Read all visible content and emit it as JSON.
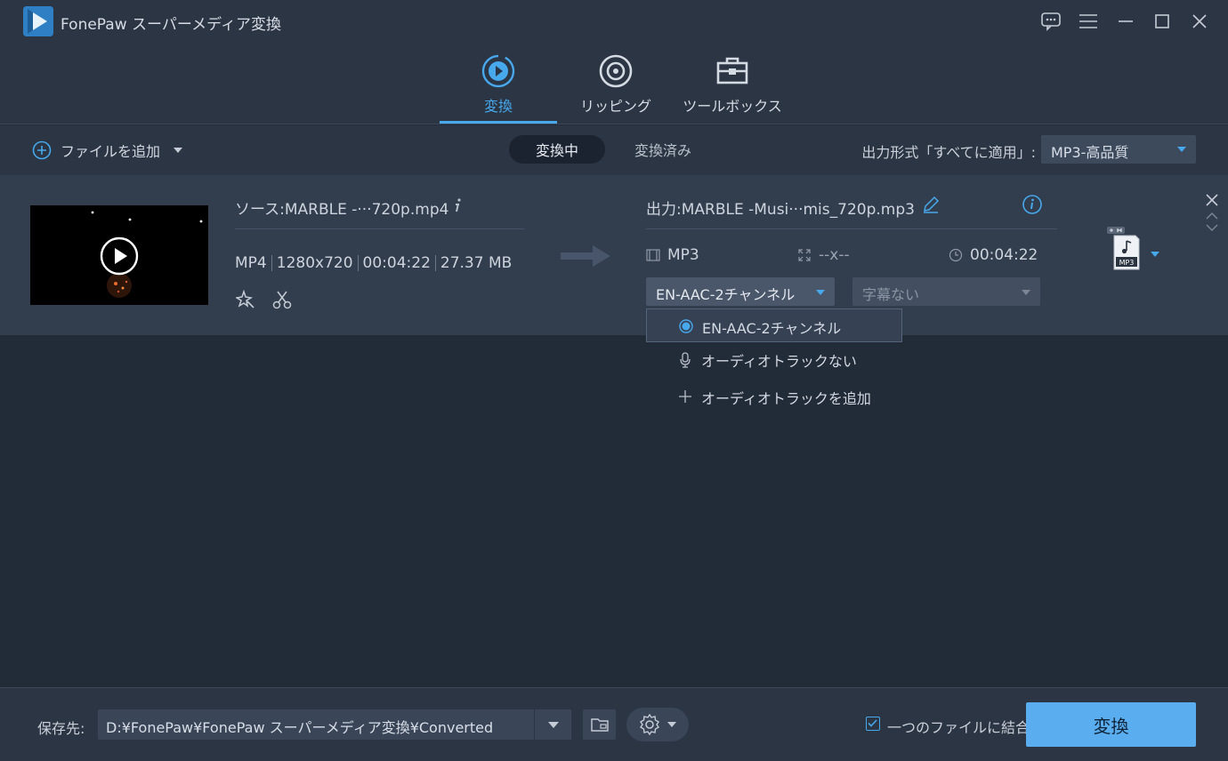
{
  "app": {
    "title": "FonePaw スーパーメディア変換",
    "accent": "#47a8ec"
  },
  "window_controls": [
    "feedback-icon",
    "menu-icon",
    "minimize-icon",
    "maximize-icon",
    "close-icon"
  ],
  "main_tabs": [
    {
      "label": "変換",
      "icon": "convert-icon",
      "active": true
    },
    {
      "label": "リッピング",
      "icon": "disc-icon",
      "active": false
    },
    {
      "label": "ツールボックス",
      "icon": "toolbox-icon",
      "active": false
    }
  ],
  "toolbar": {
    "add_file_label": "ファイルを追加",
    "seg_converting": "変換中",
    "seg_converted": "変換済み",
    "output_format_label": "出力形式「すべてに適用」:",
    "output_format_value": "MP3-高品質"
  },
  "file": {
    "source_name": "ソース:MARBLE -···720p.mp4",
    "source_format": "MP4",
    "source_resolution": "1280x720",
    "source_duration": "00:04:22",
    "source_size": "27.37 MB",
    "output_name": "出力:MARBLE -Musi···mis_720p.mp3",
    "output_format": "MP3",
    "output_resolution": "--x--",
    "output_duration": "00:04:22",
    "audio_track": "EN-AAC-2チャンネル",
    "subtitle": "字幕ない",
    "format_badge": "MP3"
  },
  "audio_menu": [
    {
      "label": "EN-AAC-2チャンネル",
      "icon": "radio-selected-icon",
      "selected": true
    },
    {
      "label": "オーディオトラックない",
      "icon": "microphone-icon",
      "selected": false
    },
    {
      "label": "オーディオトラックを追加",
      "icon": "plus-icon",
      "selected": false
    }
  ],
  "bottom": {
    "save_label": "保存先:",
    "save_path": "D:¥FonePaw¥FonePaw スーパーメディア変換¥Converted",
    "merge_label": "一つのファイルに結合",
    "merge_checked": true,
    "convert_label": "変換"
  }
}
